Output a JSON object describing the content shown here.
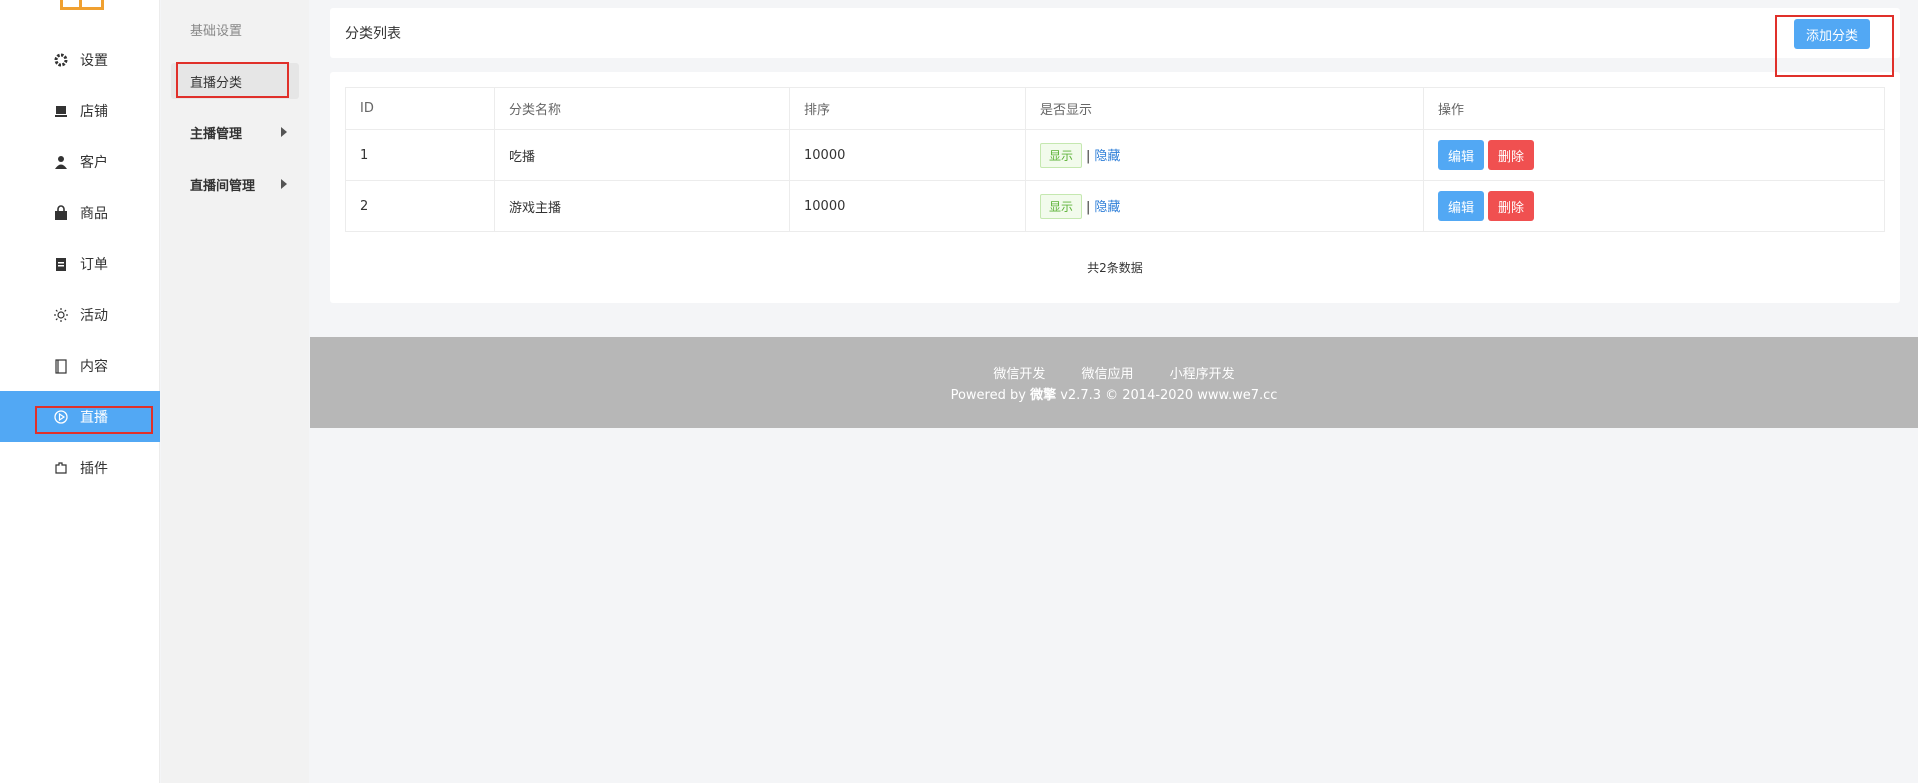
{
  "sidebar": {
    "items": [
      {
        "label": "设置",
        "icon": "gear-icon"
      },
      {
        "label": "店铺",
        "icon": "store-icon"
      },
      {
        "label": "客户",
        "icon": "user-icon"
      },
      {
        "label": "商品",
        "icon": "bag-icon"
      },
      {
        "label": "订单",
        "icon": "clipboard-icon"
      },
      {
        "label": "活动",
        "icon": "sun-icon"
      },
      {
        "label": "内容",
        "icon": "book-icon"
      },
      {
        "label": "直播",
        "icon": "play-circle-icon",
        "active": true
      },
      {
        "label": "插件",
        "icon": "puzzle-icon"
      }
    ]
  },
  "subnav": {
    "items": [
      {
        "label": "基础设置"
      },
      {
        "label": "直播分类",
        "selected": true
      },
      {
        "label": "主播管理"
      },
      {
        "label": "直播间管理"
      }
    ]
  },
  "header": {
    "title": "分类列表",
    "add_button": "添加分类"
  },
  "table": {
    "columns": [
      "ID",
      "分类名称",
      "排序",
      "是否显示",
      "操作"
    ],
    "rows": [
      {
        "id": "1",
        "name": "吃播",
        "sort": "10000",
        "show": "显示",
        "hide": "隐藏",
        "edit": "编辑",
        "delete": "删除"
      },
      {
        "id": "2",
        "name": "游戏主播",
        "sort": "10000",
        "show": "显示",
        "hide": "隐藏",
        "edit": "编辑",
        "delete": "删除"
      }
    ],
    "separator": "|",
    "total": "共2条数据"
  },
  "footer": {
    "links": [
      "微信开发",
      "微信应用",
      "小程序开发"
    ],
    "powered_prefix": "Powered by",
    "brand": "微擎",
    "version": "v2.7.3 © 2014-2020 www.we7.cc"
  },
  "colors": {
    "accent": "#52a8f4",
    "danger": "#f05050",
    "success": "#5fb33a",
    "annotation": "#e0302a"
  }
}
